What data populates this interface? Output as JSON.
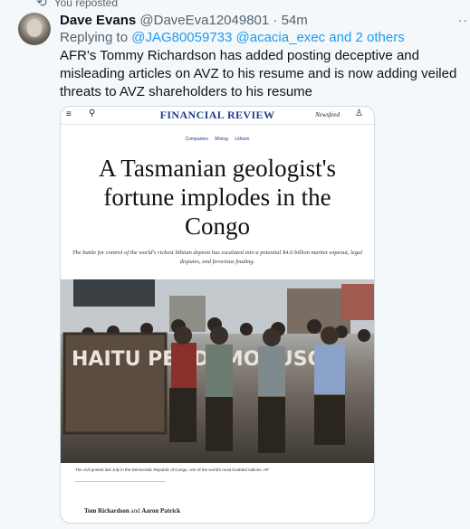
{
  "repost": {
    "label": "You reposted"
  },
  "tweet": {
    "display_name": "Dave Evans",
    "handle": "@DaveEva12049801",
    "separator": "·",
    "time": "54m",
    "reply_prefix": "Replying to",
    "reply_targets": "@JAG80059733 @acacia_exec and 2 others",
    "text": "AFR's Tommy Richardson has added posting deceptive and misleading articles on AVZ to his resume and is now adding veiled threats to AVZ shareholders to his resume"
  },
  "card": {
    "masthead": "FINANCIAL REVIEW",
    "newsfeed": "Newsfeed",
    "tags": "Companies Mining Lithium",
    "headline": "A Tasmanian geologist's fortune implodes in the Congo",
    "standfirst": "The battle for control of the world's richest lithium deposit has escalated into a potential $4.6 billion market wipeout, legal disputes, and ferocious feuding.",
    "sign_text": "HAITU PENDI MONUSCO",
    "caption": "The civil protest last July in the Democratic Republic of Congo, one of the world's most troubled nations. AP",
    "byline_author1": "Tom Richardson",
    "byline_and": "and",
    "byline_author2": "Aaron Patrick"
  },
  "icons": {
    "repost": "repost-icon",
    "more": "more-icon",
    "menu": "menu-icon",
    "search": "search-icon",
    "user": "user-icon"
  }
}
